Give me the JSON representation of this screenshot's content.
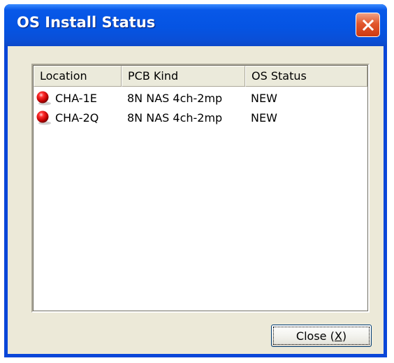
{
  "window": {
    "title": "OS Install Status",
    "close_icon": "close-x-icon"
  },
  "listview": {
    "columns": [
      "Location",
      "PCB Kind",
      "OS Status"
    ],
    "rows": [
      {
        "icon": "red-ball-icon",
        "location": "CHA-1E",
        "pcb_kind": "8N NAS 4ch-2mp",
        "os_status": "NEW"
      },
      {
        "icon": "red-ball-icon",
        "location": "CHA-2Q",
        "pcb_kind": "8N NAS 4ch-2mp",
        "os_status": "NEW"
      }
    ]
  },
  "buttons": {
    "close_label_prefix": "Close (",
    "close_label_key": "X",
    "close_label_suffix": ")"
  },
  "colors": {
    "titlebar": "#0554e3",
    "client_bg": "#ece9d8",
    "close_x": "#e2562c"
  }
}
